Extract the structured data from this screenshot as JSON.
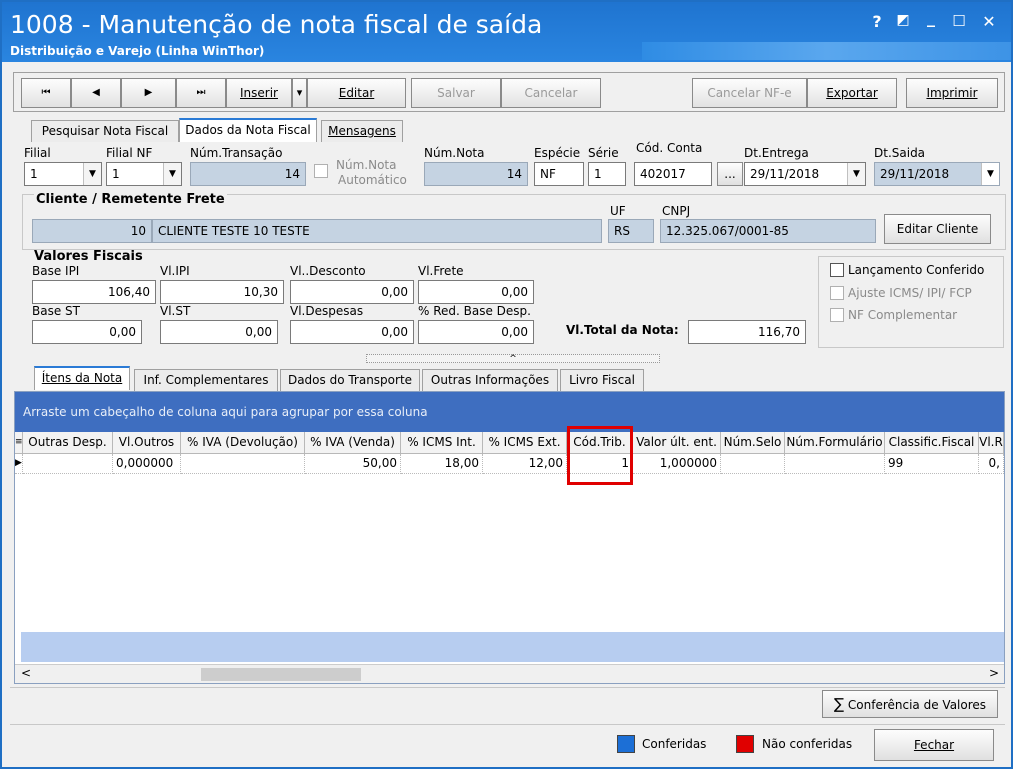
{
  "window": {
    "title": "1008 - Manutenção de nota fiscal de saída",
    "subtitle": "Distribuição e Varejo (Linha WinThor)",
    "controls": {
      "help": "?",
      "restore": "◩",
      "minimize": "_",
      "maximize": "☐",
      "close": "✕"
    }
  },
  "toolbar": {
    "first": "⏮",
    "prev": "◀",
    "next": "▶",
    "last": "⏭",
    "insert": "Inserir",
    "insert_dropdown": "▾",
    "edit": "Editar",
    "save": "Salvar",
    "cancel": "Cancelar",
    "cancel_nfe": "Cancelar NF-e",
    "export": "Exportar",
    "print": "Imprimir"
  },
  "top_tabs": [
    "Pesquisar Nota Fiscal",
    "Dados da Nota Fiscal",
    "Mensagens"
  ],
  "header": {
    "filial_label": "Filial",
    "filial_value": "1",
    "filial_nf_label": "Filial NF",
    "filial_nf_value": "1",
    "num_transacao_label": "Núm.Transação",
    "num_transacao_value": "14",
    "num_nota_auto_label_1": "Núm.Nota",
    "num_nota_auto_label_2": "Automático",
    "num_nota_label": "Núm.Nota",
    "num_nota_value": "14",
    "especie_label": "Espécie",
    "especie_value": "NF",
    "serie_label": "Série",
    "serie_value": "1",
    "cod_conta_label": "Cód. Conta",
    "cod_conta_value": "402017",
    "cod_conta_btn": "...",
    "dt_entrega_label": "Dt.Entrega",
    "dt_entrega_value": "29/11/2018",
    "dt_saida_label": "Dt.Saida",
    "dt_saida_value": "29/11/2018"
  },
  "cliente": {
    "section_title": "Cliente / Remetente Frete",
    "code": "10",
    "name": "CLIENTE TESTE 10 TESTE",
    "uf_label": "UF",
    "uf_value": "RS",
    "cnpj_label": "CNPJ",
    "cnpj_value": "12.325.067/0001-85",
    "edit_button": "Editar Cliente"
  },
  "valores": {
    "section_title": "Valores Fiscais",
    "base_ipi_label": "Base IPI",
    "base_ipi": "106,40",
    "vl_ipi_label": "Vl.IPI",
    "vl_ipi": "10,30",
    "vl_desconto_label": "Vl..Desconto",
    "vl_desconto": "0,00",
    "vl_frete_label": "Vl.Frete",
    "vl_frete": "0,00",
    "base_st_label": "Base ST",
    "base_st": "0,00",
    "vl_st_label": "Vl.ST",
    "vl_st": "0,00",
    "vl_despesas_label": "Vl.Despesas",
    "vl_despesas": "0,00",
    "red_base_label": "% Red. Base Desp.",
    "red_base": "0,00",
    "total_label": "Vl.Total da Nota:",
    "total": "116,70"
  },
  "flags": {
    "lancamento": "Lançamento Conferido",
    "ajuste": "Ajuste ICMS/ IPI/ FCP",
    "nf_compl": "NF Complementar"
  },
  "splitter": "^",
  "inner_tabs": [
    "Ítens da Nota",
    "Inf. Complementares",
    "Dados do Transporte",
    "Outras Informações",
    "Livro Fiscal"
  ],
  "grid": {
    "group_hint": "Arraste um cabeçalho de coluna aqui para agrupar por essa coluna",
    "columns": [
      "Outras Desp.",
      "Vl.Outros",
      "% IVA (Devolução)",
      "% IVA (Venda)",
      "% ICMS Int.",
      "% ICMS Ext.",
      "Cód.Trib.",
      "Valor últ. ent.",
      "Núm.Selo",
      "Núm.Formulário",
      "Classific.Fiscal",
      "Vl.R"
    ],
    "row": [
      "",
      "0,000000",
      "",
      "50,00",
      "18,00",
      "12,00",
      "1",
      "1,000000",
      "",
      "",
      "99",
      "0,"
    ],
    "scroll_left": "<",
    "scroll_right": ">"
  },
  "footer": {
    "conferencia": "Conferência de Valores",
    "legend_conferidas": "Conferidas",
    "legend_nao": "Não conferidas",
    "close": "Fechar",
    "color_conferidas": "#1c6fd6",
    "color_nao": "#e00000"
  },
  "highlight_color": "#e00000"
}
